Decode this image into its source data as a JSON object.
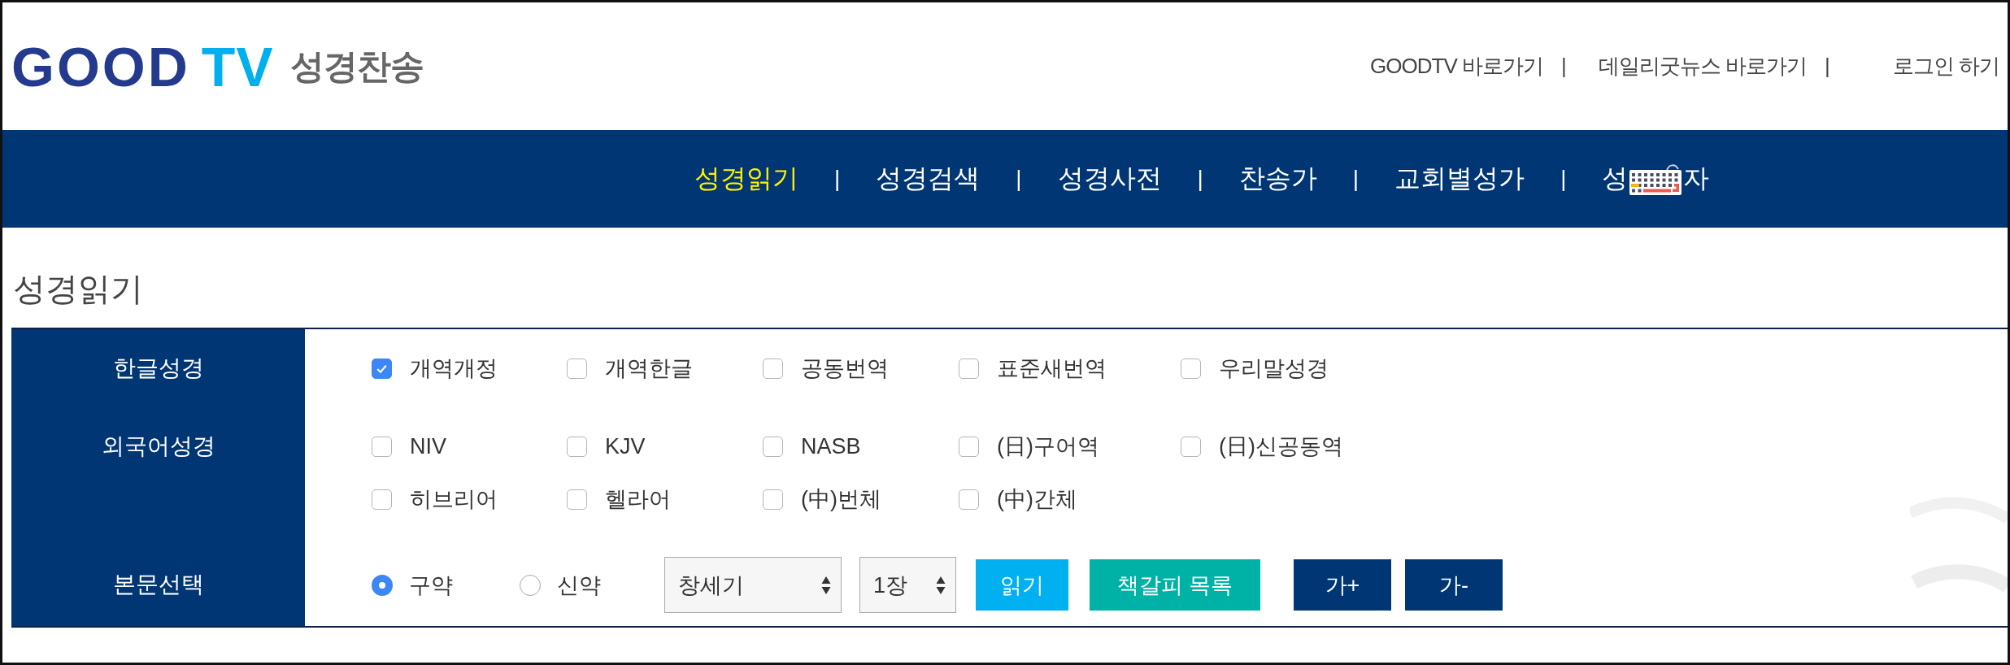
{
  "header": {
    "logo": {
      "primary": "GOOD",
      "accent": "TV"
    },
    "subtitle": "성경찬송",
    "links": [
      {
        "label": "GOODTV 바로가기",
        "separator": "|"
      },
      {
        "label": "데일리굿뉴스 바로가기",
        "separator": "|"
      },
      {
        "label": "로그인 하기"
      }
    ]
  },
  "nav": {
    "items": [
      {
        "kind": "text",
        "label": "성경읽기",
        "selected": true,
        "separator": "|"
      },
      {
        "kind": "text",
        "label": "성경검색",
        "selected": false,
        "separator": "|"
      },
      {
        "kind": "text",
        "label": "성경사전",
        "selected": false,
        "separator": "|"
      },
      {
        "kind": "text",
        "label": "찬송가",
        "selected": false,
        "separator": "|"
      },
      {
        "kind": "text",
        "label": "교회별성가",
        "selected": false,
        "separator": "|"
      },
      {
        "kind": "covered",
        "label_before": "성",
        "label_after": "자",
        "selected": false
      }
    ]
  },
  "page_title": "성경읽기",
  "form": {
    "rows": [
      {
        "kind": "checkboxes",
        "label": "한글성경",
        "options": [
          {
            "label": "개역개정",
            "checked": true
          },
          {
            "label": "개역한글",
            "checked": false
          },
          {
            "label": "공동번역",
            "checked": false
          },
          {
            "label": "표준새번역",
            "checked": false
          },
          {
            "label": "우리말성경",
            "checked": false
          }
        ]
      },
      {
        "kind": "checkboxes",
        "label": "외국어성경",
        "options": [
          {
            "label": "NIV",
            "checked": false
          },
          {
            "label": "KJV",
            "checked": false
          },
          {
            "label": "NASB",
            "checked": false
          },
          {
            "label": "(日)구어역",
            "checked": false
          },
          {
            "label": "(日)신공동역",
            "checked": false
          },
          {
            "label": "히브리어",
            "checked": false
          },
          {
            "label": "헬라어",
            "checked": false
          },
          {
            "label": "(中)번체",
            "checked": false
          },
          {
            "label": "(中)간체",
            "checked": false
          }
        ]
      },
      {
        "kind": "reading",
        "label": "본문선택",
        "radios": [
          {
            "label": "구약",
            "selected": true
          },
          {
            "label": "신약",
            "selected": false
          }
        ],
        "selects": [
          {
            "value": "창세기"
          },
          {
            "value": "1장"
          }
        ],
        "buttons": [
          {
            "kind": "read",
            "label": "읽기"
          },
          {
            "kind": "bookmark",
            "label": "책갈피 목록"
          },
          {
            "kind": "font",
            "label": "가+"
          },
          {
            "kind": "font",
            "label": "가-"
          }
        ]
      }
    ]
  }
}
